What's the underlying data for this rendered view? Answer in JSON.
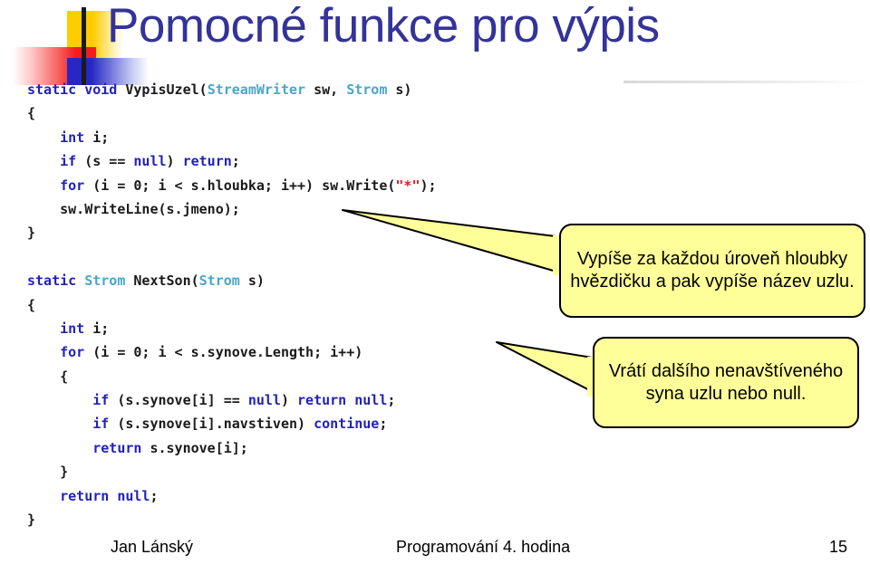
{
  "slide": {
    "title": "Pomocné funkce pro výpis",
    "title_color": "#333399",
    "background": "#ffffff"
  },
  "logo": {
    "name": "decorative-logo",
    "shapes": [
      {
        "name": "yellow-square",
        "color": "#ffcc00"
      },
      {
        "name": "red-square",
        "color": "#f51b1b"
      },
      {
        "name": "blue-square",
        "color": "#2727c4"
      },
      {
        "name": "black-bar",
        "color": "#1a1a1a"
      }
    ]
  },
  "code": {
    "language": "csharp",
    "colors": {
      "keyword": "#2222bb",
      "type": "#4aa6c8",
      "string": "#cc2222",
      "plain": "#1a1a1a"
    },
    "lines": [
      [
        {
          "t": "static void ",
          "c": "kw"
        },
        {
          "t": "VypisUzel(",
          "c": "pl"
        },
        {
          "t": "StreamWriter",
          "c": "typ"
        },
        {
          "t": " sw, ",
          "c": "pl"
        },
        {
          "t": "Strom",
          "c": "typ"
        },
        {
          "t": " s)",
          "c": "pl"
        }
      ],
      [
        {
          "t": "{",
          "c": "pl"
        }
      ],
      [
        {
          "t": "    ",
          "c": "pl"
        },
        {
          "t": "int",
          "c": "kw"
        },
        {
          "t": " i;",
          "c": "pl"
        }
      ],
      [
        {
          "t": "    ",
          "c": "pl"
        },
        {
          "t": "if",
          "c": "kw"
        },
        {
          "t": " (s == ",
          "c": "pl"
        },
        {
          "t": "null",
          "c": "kw"
        },
        {
          "t": ") ",
          "c": "pl"
        },
        {
          "t": "return",
          "c": "kw"
        },
        {
          "t": ";",
          "c": "pl"
        }
      ],
      [
        {
          "t": "    ",
          "c": "pl"
        },
        {
          "t": "for",
          "c": "kw"
        },
        {
          "t": " (i = 0; i < s.hloubka; i++) sw.Write(",
          "c": "pl"
        },
        {
          "t": "\"*\"",
          "c": "str"
        },
        {
          "t": ");",
          "c": "pl"
        }
      ],
      [
        {
          "t": "    sw.WriteLine(s.jmeno);",
          "c": "pl"
        }
      ],
      [
        {
          "t": "}",
          "c": "pl"
        }
      ],
      [
        {
          "t": "",
          "c": "pl"
        }
      ],
      [
        {
          "t": "static ",
          "c": "kw"
        },
        {
          "t": "Strom",
          "c": "typ"
        },
        {
          "t": " NextSon(",
          "c": "pl"
        },
        {
          "t": "Strom",
          "c": "typ"
        },
        {
          "t": " s)",
          "c": "pl"
        }
      ],
      [
        {
          "t": "{",
          "c": "pl"
        }
      ],
      [
        {
          "t": "    ",
          "c": "pl"
        },
        {
          "t": "int",
          "c": "kw"
        },
        {
          "t": " i;",
          "c": "pl"
        }
      ],
      [
        {
          "t": "    ",
          "c": "pl"
        },
        {
          "t": "for",
          "c": "kw"
        },
        {
          "t": " (i = 0; i < s.synove.Length; i++)",
          "c": "pl"
        }
      ],
      [
        {
          "t": "    {",
          "c": "pl"
        }
      ],
      [
        {
          "t": "        ",
          "c": "pl"
        },
        {
          "t": "if",
          "c": "kw"
        },
        {
          "t": " (s.synove[i] == ",
          "c": "pl"
        },
        {
          "t": "null",
          "c": "kw"
        },
        {
          "t": ") ",
          "c": "pl"
        },
        {
          "t": "return null",
          "c": "kw"
        },
        {
          "t": ";",
          "c": "pl"
        }
      ],
      [
        {
          "t": "        ",
          "c": "pl"
        },
        {
          "t": "if",
          "c": "kw"
        },
        {
          "t": " (s.synove[i].navstiven) ",
          "c": "pl"
        },
        {
          "t": "continue",
          "c": "kw"
        },
        {
          "t": ";",
          "c": "pl"
        }
      ],
      [
        {
          "t": "        ",
          "c": "pl"
        },
        {
          "t": "return",
          "c": "kw"
        },
        {
          "t": " s.synove[i];",
          "c": "pl"
        }
      ],
      [
        {
          "t": "    }",
          "c": "pl"
        }
      ],
      [
        {
          "t": "    ",
          "c": "pl"
        },
        {
          "t": "return null",
          "c": "kw"
        },
        {
          "t": ";",
          "c": "pl"
        }
      ],
      [
        {
          "t": "}",
          "c": "pl"
        }
      ]
    ]
  },
  "callouts": [
    {
      "id": "callout-1",
      "text": "Vypíše za každou úroveň hloubky hvězdičku a pak vypíše název uzlu.",
      "fill": "#ffff99",
      "border": "#000000"
    },
    {
      "id": "callout-2",
      "text": "Vrátí dalšího nenavštíveného syna uzlu nebo null.",
      "fill": "#ffff99",
      "border": "#000000"
    }
  ],
  "footer": {
    "author": "Jan Lánský",
    "center": "Programování 4. hodina",
    "page": "15"
  }
}
